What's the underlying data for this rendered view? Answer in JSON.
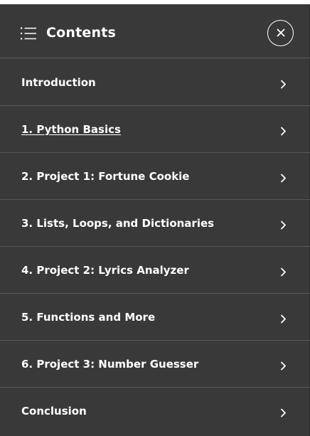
{
  "header": {
    "title": "Contents",
    "menu_icon": "list-icon",
    "close_icon": "close-icon"
  },
  "toc": {
    "items": [
      {
        "label": "Introduction",
        "active": false
      },
      {
        "label": "1. Python Basics",
        "active": true
      },
      {
        "label": "2. Project 1: Fortune Cookie",
        "active": false
      },
      {
        "label": "3. Lists, Loops, and Dictionaries",
        "active": false
      },
      {
        "label": "4. Project 2: Lyrics Analyzer",
        "active": false
      },
      {
        "label": "5. Functions and More",
        "active": false
      },
      {
        "label": "6. Project 3: Number Guesser",
        "active": false
      },
      {
        "label": "Conclusion",
        "active": false
      }
    ],
    "item_icon": "chevron-right-icon"
  },
  "colors": {
    "panel_bg": "#393939",
    "divider": "#575757",
    "text": "#ffffff"
  }
}
